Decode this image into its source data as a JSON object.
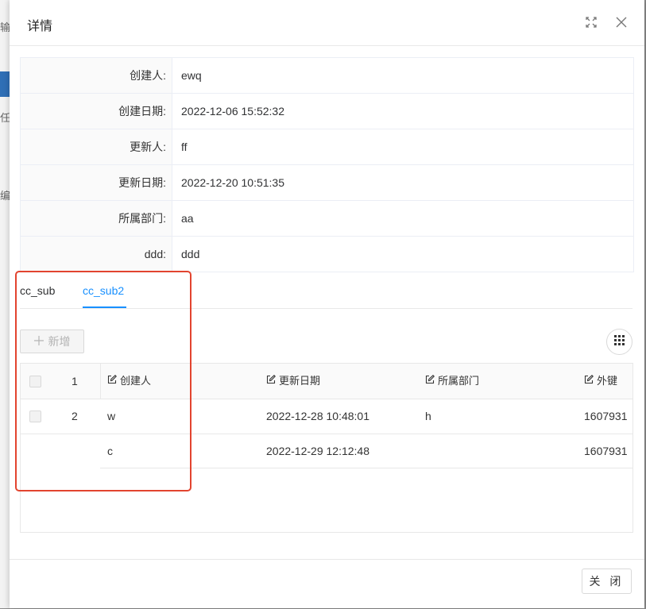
{
  "background": {
    "fragments": [
      "输入",
      "任",
      "编"
    ]
  },
  "modal": {
    "title": "详情",
    "fullscreen_icon": "fullscreen-icon",
    "close_icon": "close-icon"
  },
  "details": [
    {
      "label": "创建人:",
      "value": "ewq"
    },
    {
      "label": "创建日期:",
      "value": "2022-12-06 15:52:32"
    },
    {
      "label": "更新人:",
      "value": "ff"
    },
    {
      "label": "更新日期:",
      "value": "2022-12-20 10:51:35"
    },
    {
      "label": "所属部门:",
      "value": "aa"
    },
    {
      "label": "ddd:",
      "value": "ddd"
    }
  ],
  "tabs": [
    {
      "label": "cc_sub",
      "active": false
    },
    {
      "label": "cc_sub2",
      "active": true
    }
  ],
  "toolbar": {
    "add_label": "新增",
    "add_icon": "plus-icon",
    "columns_icon": "grid-icon"
  },
  "table": {
    "columns": [
      "创建人",
      "更新日期",
      "所属部门",
      "外键"
    ],
    "rows": [
      {
        "index": "1",
        "creator": "",
        "update_date": "",
        "department": "",
        "fk": ""
      },
      {
        "index": "2",
        "creator": "w",
        "update_date": "2022-12-28 10:48:01",
        "department": "h",
        "fk": "1607931"
      },
      {
        "index": "",
        "creator": "c",
        "update_date": "2022-12-29 12:12:48",
        "department": "",
        "fk": "1607931"
      }
    ]
  },
  "footer": {
    "close_label": "关 闭"
  },
  "colors": {
    "accent": "#1890ff",
    "highlight": "#e2442f"
  }
}
